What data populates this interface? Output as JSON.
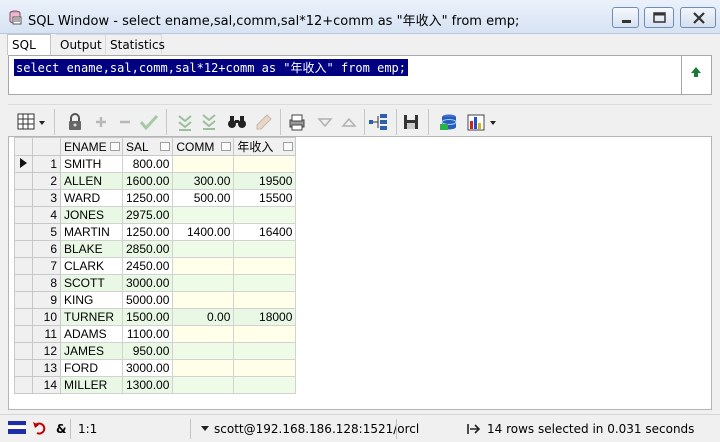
{
  "window": {
    "title": "SQL Window - select ename,sal,comm,sal*12+comm as \"年收入\" from emp;"
  },
  "tabs": [
    {
      "label": "SQL",
      "active": true
    },
    {
      "label": "Output",
      "active": false
    },
    {
      "label": "Statistics",
      "active": false
    }
  ],
  "editor": {
    "sql": "select ename,sal,comm,sal*12+comm as \"年收入\" from emp;"
  },
  "toolbar": {
    "icons": [
      "grid-icon",
      "lock-icon",
      "add-icon",
      "remove-icon",
      "check-icon",
      "arrow-down-icon",
      "arrow-down-last-icon",
      "binoculars-icon",
      "clear-icon",
      "print-icon",
      "triangle-down-icon",
      "triangle-up-icon",
      "tree-icon",
      "save-icon",
      "database-icon",
      "chart-icon"
    ]
  },
  "grid": {
    "columns": [
      "ENAME",
      "SAL",
      "COMM",
      "年收入"
    ],
    "rows": [
      {
        "n": "1",
        "ename": "SMITH",
        "sal": "800.00",
        "comm": "",
        "income": ""
      },
      {
        "n": "2",
        "ename": "ALLEN",
        "sal": "1600.00",
        "comm": "300.00",
        "income": "19500"
      },
      {
        "n": "3",
        "ename": "WARD",
        "sal": "1250.00",
        "comm": "500.00",
        "income": "15500"
      },
      {
        "n": "4",
        "ename": "JONES",
        "sal": "2975.00",
        "comm": "",
        "income": ""
      },
      {
        "n": "5",
        "ename": "MARTIN",
        "sal": "1250.00",
        "comm": "1400.00",
        "income": "16400"
      },
      {
        "n": "6",
        "ename": "BLAKE",
        "sal": "2850.00",
        "comm": "",
        "income": ""
      },
      {
        "n": "7",
        "ename": "CLARK",
        "sal": "2450.00",
        "comm": "",
        "income": ""
      },
      {
        "n": "8",
        "ename": "SCOTT",
        "sal": "3000.00",
        "comm": "",
        "income": ""
      },
      {
        "n": "9",
        "ename": "KING",
        "sal": "5000.00",
        "comm": "",
        "income": ""
      },
      {
        "n": "10",
        "ename": "TURNER",
        "sal": "1500.00",
        "comm": "0.00",
        "income": "18000"
      },
      {
        "n": "11",
        "ename": "ADAMS",
        "sal": "1100.00",
        "comm": "",
        "income": ""
      },
      {
        "n": "12",
        "ename": "JAMES",
        "sal": "950.00",
        "comm": "",
        "income": ""
      },
      {
        "n": "13",
        "ename": "FORD",
        "sal": "3000.00",
        "comm": "",
        "income": ""
      },
      {
        "n": "14",
        "ename": "MILLER",
        "sal": "1300.00",
        "comm": "",
        "income": ""
      }
    ]
  },
  "status": {
    "ampersand": "&",
    "position": "1:1",
    "connection": "scott@192.168.186.128:1521/orcl",
    "message": "14 rows selected in 0.031 seconds"
  },
  "colors": {
    "selection": "#000080",
    "row_alt": "#e8f8e4",
    "empty_cell": "#ffffea"
  }
}
